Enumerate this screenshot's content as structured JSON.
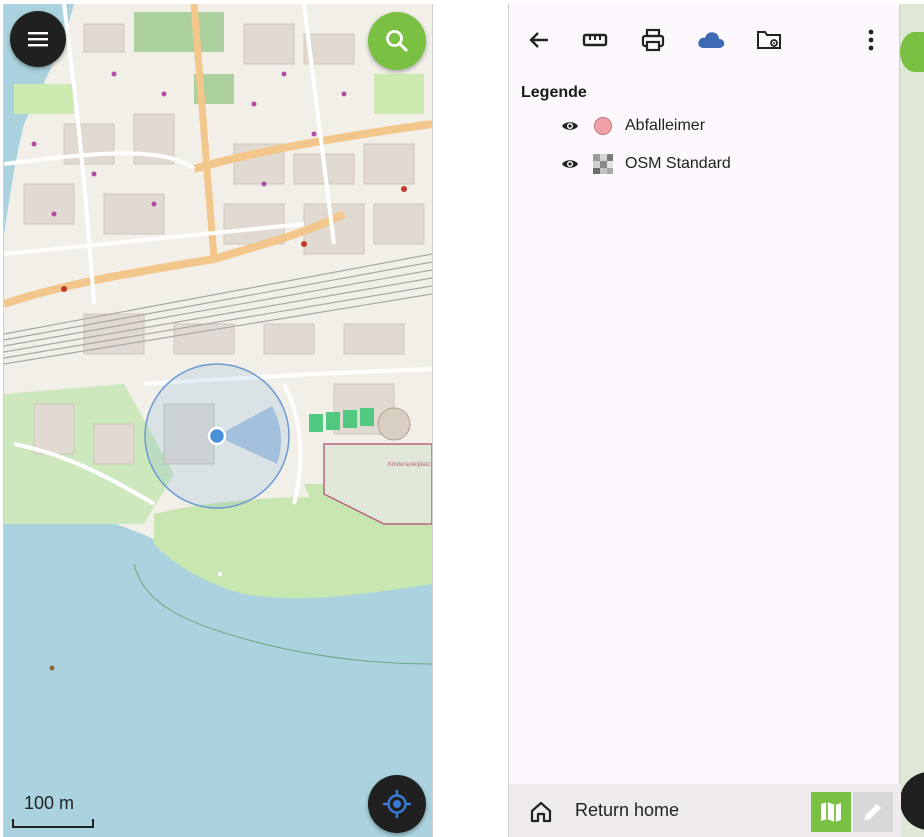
{
  "map_screen": {
    "menu_icon": "hamburger-menu-icon",
    "search_icon": "search-icon",
    "locate_icon": "gps-locate-icon",
    "scale_label": "100 m",
    "labels": {
      "kinderspielplatz": "Kinderspielplatz"
    },
    "colors": {
      "accent_green": "#7ac143",
      "fab_dark": "#202020",
      "water": "#aad3df",
      "park": "#c8e6b0",
      "road_major": "#fcd6a4",
      "railway": "#999999",
      "location": "#4a90d9"
    }
  },
  "legend_screen": {
    "toolbar": {
      "back_icon": "back-arrow-icon",
      "measure_icon": "ruler-icon",
      "print_icon": "print-icon",
      "cloud_icon": "cloud-icon",
      "folder_icon": "folder-settings-icon",
      "more_icon": "more-vertical-icon"
    },
    "legend_title": "Legende",
    "layers": [
      {
        "label": "Abfalleimer",
        "visible_icon": "eye-icon",
        "swatch": "pink-circle"
      },
      {
        "label": "OSM Standard",
        "visible_icon": "eye-icon",
        "swatch": "checker-tile"
      }
    ],
    "bottom_bar": {
      "home_icon": "home-icon",
      "home_label": "Return home",
      "map_icon": "map-icon",
      "edit_icon": "pencil-icon"
    },
    "colors": {
      "panel_bg": "#fdf8fd",
      "cloud": "#3e6ab3",
      "abfalleimer_swatch": "#f0a0a8",
      "bottom_bar_bg": "#eeeaee"
    }
  }
}
